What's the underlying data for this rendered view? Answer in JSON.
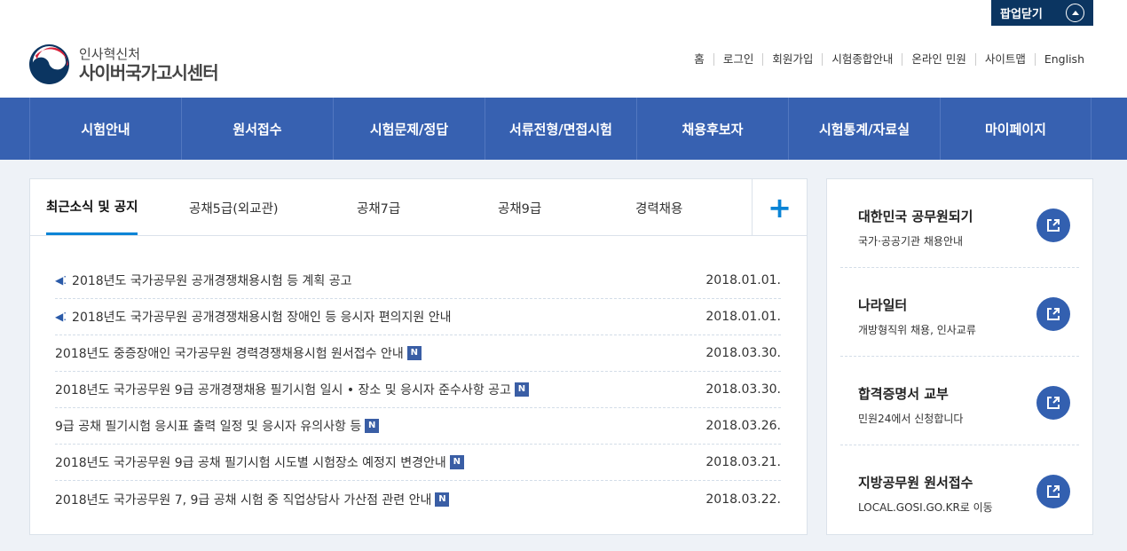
{
  "popup": {
    "label": "팝업닫기",
    "icon": "chevron-up-circle-icon"
  },
  "logo": {
    "org": "인사혁신처",
    "site": "사이버국가고시센터"
  },
  "util_links": [
    "홈",
    "로그인",
    "회원가입",
    "시험종합안내",
    "온라인 민원",
    "사이트맵",
    "English"
  ],
  "nav": [
    "시험안내",
    "원서접수",
    "시험문제/정답",
    "서류전형/면접시험",
    "채용후보자",
    "시험통계/자료실",
    "마이페이지"
  ],
  "tabs": [
    {
      "label": "최근소식 및 공지",
      "active": true
    },
    {
      "label": "공채5급(외교관)"
    },
    {
      "label": "공채7급"
    },
    {
      "label": "공채9급"
    },
    {
      "label": "경력채용"
    }
  ],
  "more_label": "+",
  "notices": [
    {
      "title": "2018년도 국가공무원 공개경쟁채용시험 등 계획 공고",
      "date": "2018.01.01.",
      "speaker": true,
      "new": false
    },
    {
      "title": "2018년도 국가공무원 공개경쟁채용시험 장애인 등 응시자 편의지원 안내",
      "date": "2018.01.01.",
      "speaker": true,
      "new": false
    },
    {
      "title": "2018년도 중증장애인 국가공무원 경력경쟁채용시험 원서접수 안내",
      "date": "2018.03.30.",
      "speaker": false,
      "new": true
    },
    {
      "title": "2018년도 국가공무원 9급 공개경쟁채용 필기시험 일시 • 장소 및 응시자 준수사항 공고",
      "date": "2018.03.30.",
      "speaker": false,
      "new": true
    },
    {
      "title": "9급 공채 필기시험 응시표 출력 일정 및 응시자 유의사항 등",
      "date": "2018.03.26.",
      "speaker": false,
      "new": true
    },
    {
      "title": "2018년도 국가공무원 9급 공채 필기시험 시도별 시험장소 예정지 변경안내",
      "date": "2018.03.21.",
      "speaker": false,
      "new": true
    },
    {
      "title": "2018년도 국가공무원 7, 9급 공채 시험 중 직업상담사 가산점 관련 안내",
      "date": "2018.03.22.",
      "speaker": false,
      "new": true
    }
  ],
  "new_badge": "N",
  "side_links": [
    {
      "title": "대한민국 공무원되기",
      "desc": "국가·공공기관 채용안내"
    },
    {
      "title": "나라일터",
      "desc": "개방형직위 채용, 인사교류"
    },
    {
      "title": "합격증명서 교부",
      "desc": "민원24에서 신청합니다"
    },
    {
      "title": "지방공무원 원서접수",
      "desc": "LOCAL.GOSI.GO.KR로 이동"
    }
  ],
  "colors": {
    "nav": "#3761b1",
    "popup": "#0b3561",
    "accent": "#0a84d6",
    "badge": "#3a5ea5"
  }
}
